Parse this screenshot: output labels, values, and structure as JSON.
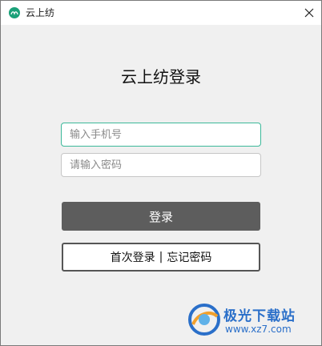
{
  "window": {
    "title": "云上纺"
  },
  "login": {
    "heading": "云上纺登录",
    "phone_placeholder": "输入手机号",
    "password_placeholder": "请输入密码",
    "login_label": "登录",
    "first_login_label": "首次登录",
    "separator": "|",
    "forgot_label": "忘记密码"
  },
  "watermark": {
    "name": "极光下载站",
    "url": "www.xz7.com"
  },
  "colors": {
    "accent": "#3cb89a",
    "button": "#5d5d5d",
    "watermark": "#2a6fc9"
  }
}
